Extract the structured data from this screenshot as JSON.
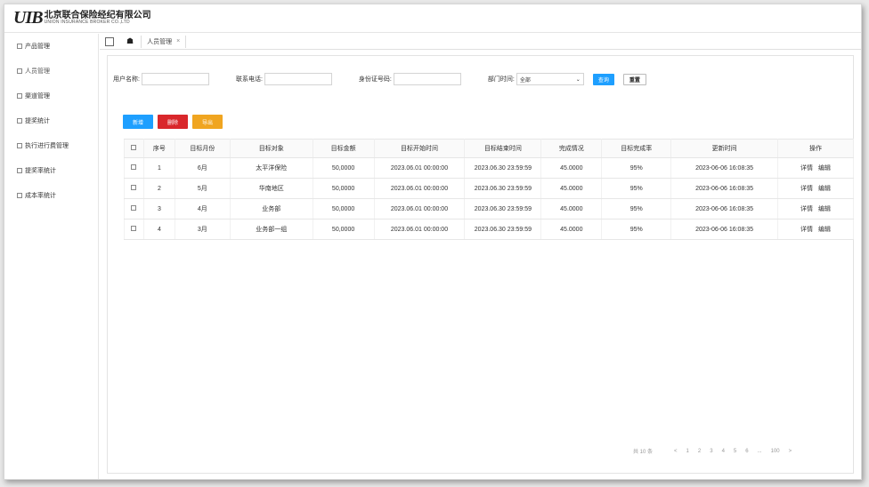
{
  "logo": {
    "mark": "UIB",
    "cn": "北京联合保险经纪有限公司",
    "en": "UNION INSURANCE BROKER CO.,LTD"
  },
  "sidebar": {
    "items": [
      {
        "label": "产品管理"
      },
      {
        "label": "人员管理"
      },
      {
        "label": "渠道管理"
      },
      {
        "label": "提奖统计"
      },
      {
        "label": "执行进行费管理"
      },
      {
        "label": "提奖率统计"
      },
      {
        "label": "成本率统计"
      }
    ]
  },
  "tabs": {
    "items": [
      {
        "label": "人员管理",
        "close": "×"
      }
    ]
  },
  "filter": {
    "user_label": "用户名称:",
    "dept_label": "联系电话:",
    "id_label": "身份证号码:",
    "date_label": "部门时间:",
    "select_value": "全部",
    "search_btn": "查询",
    "reset_btn": "重置"
  },
  "actions": {
    "add": "新增",
    "delete": "删除",
    "export": "导出"
  },
  "table": {
    "headers": [
      "序号",
      "目标月份",
      "目标对象",
      "目标金额",
      "目标开始时间",
      "目标结束时间",
      "完成情况",
      "目标完成率",
      "更新时间",
      "操作"
    ],
    "rows": [
      [
        "1",
        "6月",
        "太平洋保险",
        "50,0000",
        "2023.06.01 00:00:00",
        "2023.06.30 23:59:59",
        "45.0000",
        "95%",
        "2023-06-06 16:08:35"
      ],
      [
        "2",
        "5月",
        "华南地区",
        "50,0000",
        "2023.06.01 00:00:00",
        "2023.06.30 23:59:59",
        "45.0000",
        "95%",
        "2023-06-06 16:08:35"
      ],
      [
        "3",
        "4月",
        "业务部",
        "50,0000",
        "2023.06.01 00:00:00",
        "2023.06.30 23:59:59",
        "45.0000",
        "95%",
        "2023-06-06 16:08:35"
      ],
      [
        "4",
        "3月",
        "业务部一组",
        "50,0000",
        "2023.06.01 00:00:00",
        "2023.06.30 23:59:59",
        "45.0000",
        "95%",
        "2023-06-06 16:08:35"
      ]
    ],
    "op_detail": "详情",
    "op_edit": "编辑"
  },
  "pagination": {
    "total": "共 10 条",
    "prev": "<",
    "pages": [
      "1",
      "2",
      "3",
      "4",
      "5",
      "6"
    ],
    "ellipsis": "...",
    "last": "100",
    "next": ">"
  },
  "colors": {
    "primary": "#1e9fff",
    "danger": "#d9272b",
    "warning": "#f0a520"
  }
}
